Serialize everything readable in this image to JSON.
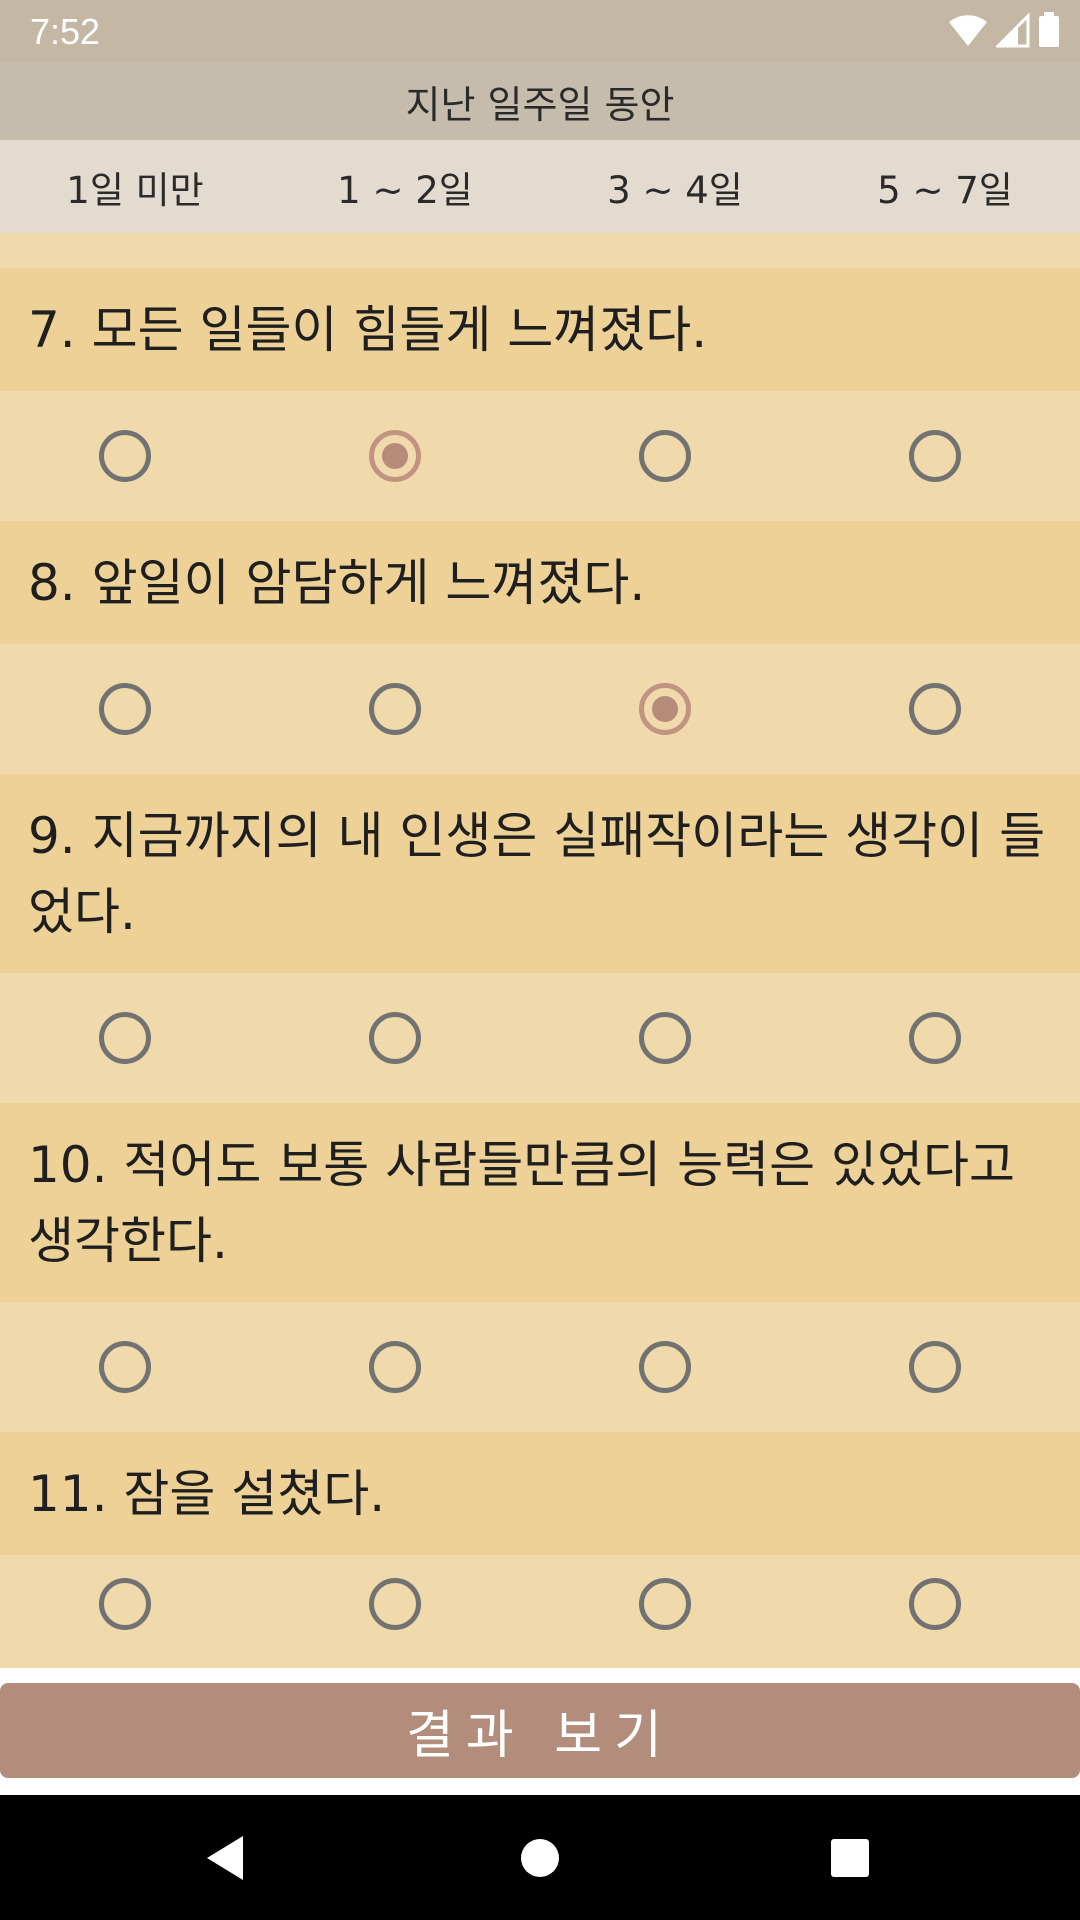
{
  "status_bar": {
    "time": "7:52",
    "icons": [
      "wifi-icon",
      "signal-icon",
      "battery-icon"
    ],
    "color": "#ffffff"
  },
  "survey": {
    "period_header": "지난 일주일 동안",
    "options": [
      "1일 미만",
      "1 ~ 2일",
      "3 ~ 4일",
      "5 ~ 7일"
    ],
    "questions": [
      {
        "text": "7. 모든 일들이 힘들게 느껴졌다.",
        "selected_index": 1
      },
      {
        "text": "8. 앞일이 암담하게 느껴졌다.",
        "selected_index": 2
      },
      {
        "text": "9. 지금까지의 내 인생은 실패작이라는 생각이 들었다.",
        "selected_index": -1
      },
      {
        "text": "10. 적어도 보통 사람들만큼의 능력은 있었다고 생각한다.",
        "selected_index": -1
      },
      {
        "text": "11. 잠을 설쳤다.",
        "selected_index": -1
      }
    ]
  },
  "actions": {
    "result_button": "결과 보기"
  },
  "nav_bar": {
    "icons": [
      "back-icon",
      "home-icon",
      "recents-icon"
    ]
  },
  "colors": {
    "question_bg": "#eed196",
    "answer_bg": "#f0d9aa",
    "accent": "#b38d7b",
    "radio_checked": "#c09480"
  }
}
